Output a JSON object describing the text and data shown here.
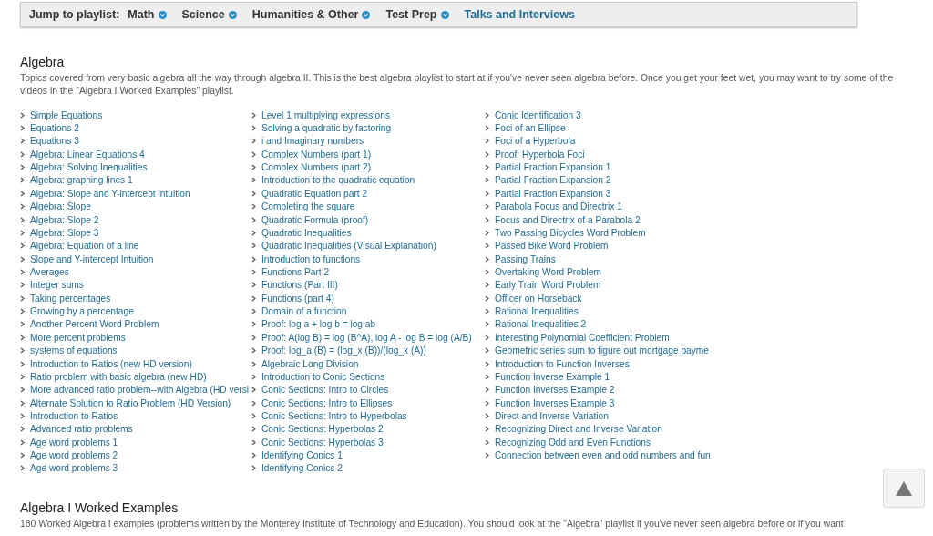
{
  "nav": {
    "label": "Jump to playlist:",
    "items": [
      {
        "label": "Math",
        "kind": "menu"
      },
      {
        "label": "Science",
        "kind": "menu"
      },
      {
        "label": "Humanities & Other",
        "kind": "menu"
      },
      {
        "label": "Test Prep",
        "kind": "menu"
      },
      {
        "label": "Talks and Interviews",
        "kind": "link"
      }
    ]
  },
  "sections": [
    {
      "title": "Algebra",
      "description": "Topics covered from very basic algebra all the way through algebra II. This is the best algebra playlist to start at if you've never seen algebra before. Once you get your feet wet, you may want to try some of the videos in the \"Algebra I Worked Examples\" playlist.",
      "columns": [
        [
          "Simple Equations",
          "Equations 2",
          "Equations 3",
          "Algebra: Linear Equations 4",
          "Algebra: Solving Inequalities",
          "Algebra: graphing lines 1",
          "Algebra: Slope and Y-intercept intuition",
          "Algebra: Slope",
          "Algebra: Slope 2",
          "Algebra: Slope 3",
          "Algebra: Equation of a line",
          "Slope and Y-intercept Intuition",
          "Averages",
          "Integer sums",
          "Taking percentages",
          "Growing by a percentage",
          "Another Percent Word Problem",
          "More percent problems",
          "systems of equations",
          "Introduction to Ratios (new HD version)",
          "Ratio problem with basic algebra (new HD)",
          "More advanced ratio problem--with Algebra (HD versi",
          "Alternate Solution to Ratio Problem (HD Version)",
          "Introduction to Ratios",
          "Advanced ratio problems",
          "Age word problems 1",
          "Age word problems 2",
          "Age word problems 3"
        ],
        [
          "Level 1 multiplying expressions",
          "Solving a quadratic by factoring",
          "i and Imaginary numbers",
          "Complex Numbers (part 1)",
          "Complex Numbers (part 2)",
          "Introduction to the quadratic equation",
          "Quadratic Equation part 2",
          "Completing the square",
          "Quadratic Formula (proof)",
          "Quadratic Inequalities",
          "Quadratic Inequalities (Visual Explanation)",
          "Introduction to functions",
          "Functions Part 2",
          "Functions (Part III)",
          "Functions (part 4)",
          "Domain of a function",
          "Proof: log a + log b = log ab",
          "Proof: A(log B) = log (B^A), log A - log B = log (A/B)",
          "Proof: log_a (B) = (log_x (B))/(log_x (A))",
          "Algebraic Long Division",
          "Introduction to Conic Sections",
          "Conic Sections: Intro to Circles",
          "Conic Sections: Intro to Ellipses",
          "Conic Sections: Intro to Hyperbolas",
          "Conic Sections: Hyperbolas 2",
          "Conic Sections: Hyperbolas 3",
          "Identifying Conics 1",
          "Identifying Conics 2"
        ],
        [
          "Conic Identification 3",
          "Foci of an Ellipse",
          "Foci of a Hyperbola",
          "Proof: Hyperbola Foci",
          "Partial Fraction Expansion 1",
          "Partial Fraction Expansion 2",
          "Partial Fraction Expansion 3",
          "Parabola Focus and Directrix 1",
          "Focus and Directrix of a Parabola 2",
          "Two Passing Bicycles Word Problem",
          "Passed Bike Word Problem",
          "Passing Trains",
          "Overtaking Word Problem",
          "Early Train Word Problem",
          "Officer on Horseback",
          "Rational Inequalities",
          "Rational Inequalities 2",
          "Interesting Polynomial Coefficient Problem",
          "Geometric series sum to figure out mortgage payme",
          "Introduction to Function Inverses",
          "Function Inverse Example 1",
          "Function Inverses Example 2",
          "Function Inverses Example 3",
          "Direct and Inverse Variation",
          "Recognizing Direct and Inverse Variation",
          "Recognizing Odd and Even Functions",
          "Connection between even and odd numbers and fun"
        ]
      ]
    },
    {
      "title": "Algebra I Worked Examples",
      "description": "180 Worked Algebra I examples (problems written by the Monterey Institute of Technology and Education). You should look at the \"Algebra\" playlist if you've never seen algebra before or if you want"
    }
  ]
}
